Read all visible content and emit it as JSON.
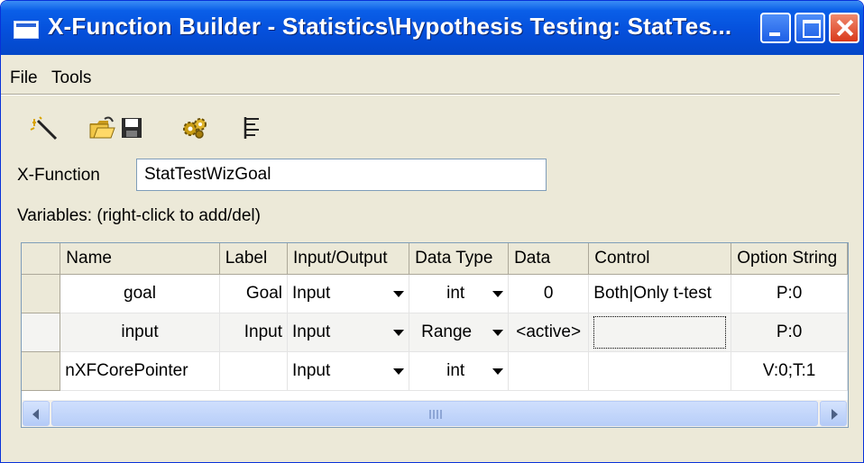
{
  "window": {
    "title": "X-Function Builder - Statistics\\Hypothesis Testing: StatTes...",
    "colors": {
      "titlebar": "#0550dc",
      "chrome": "#ece9d8",
      "close": "#d9391b"
    }
  },
  "menu": {
    "items": [
      "File",
      "Tools"
    ]
  },
  "toolbar": {
    "icons": [
      "new-wizard-icon",
      "open-folder-icon",
      "save-disk-icon",
      "gears-icon",
      "tree-view-icon"
    ]
  },
  "xfunction": {
    "label": "X-Function",
    "value": "StatTestWizGoal"
  },
  "variables_hint": "Variables: (right-click to add/del)",
  "grid": {
    "columns": [
      "Name",
      "Label",
      "Input/Output",
      "Data Type",
      "Data",
      "Control",
      "Option String"
    ],
    "rows": [
      {
        "name": "goal",
        "label": "Goal",
        "io": "Input",
        "type": "int",
        "data": "0",
        "control": "Both|Only t-test",
        "option": "P:0"
      },
      {
        "name": "input",
        "label": "Input",
        "io": "Input",
        "type": "Range",
        "data": "<active>",
        "control": "",
        "option": "P:0"
      },
      {
        "name": "nXFCorePointer",
        "label": "",
        "io": "Input",
        "type": "int",
        "data": "",
        "control": "",
        "option": "V:0;T:1"
      }
    ]
  }
}
